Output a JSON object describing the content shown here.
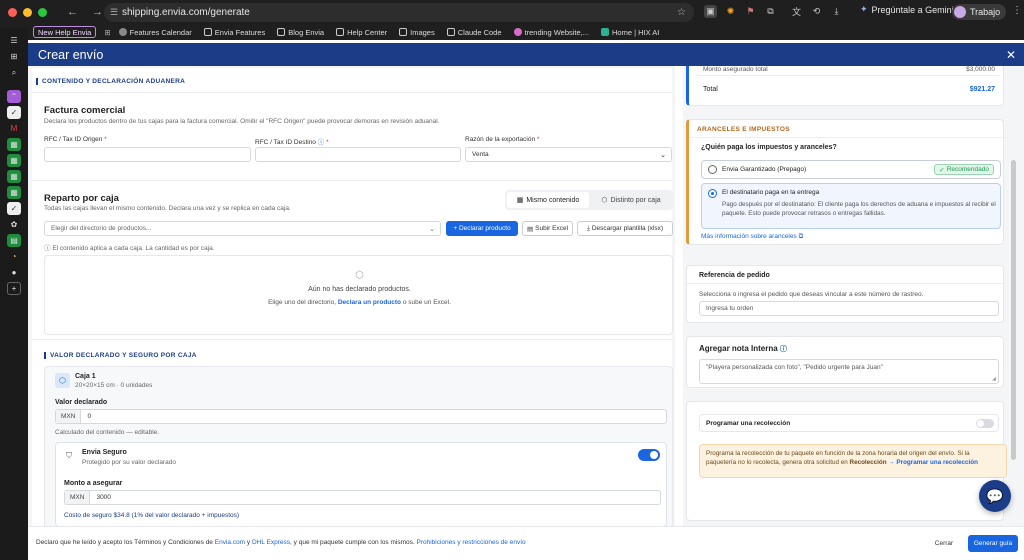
{
  "browser": {
    "url": "shipping.envia.com/generate",
    "gemini_label": "Pregúntale a Gemini",
    "profile_label": "Trabajo",
    "bookmarks": [
      {
        "label": "New Help Envia"
      },
      {
        "label": "Features Calendar"
      },
      {
        "label": "Envia Features"
      },
      {
        "label": "Blog Envia"
      },
      {
        "label": "Help Center"
      },
      {
        "label": "Images"
      },
      {
        "label": "Claude Code"
      },
      {
        "label": "trending Website,..."
      },
      {
        "label": "Home | HIX AI"
      }
    ]
  },
  "header": {
    "title": "Crear envío",
    "close": "✕"
  },
  "customs": {
    "section_title": "CONTENIDO Y DECLARACIÓN ADUANERA",
    "invoice_title": "Factura comercial",
    "invoice_desc": "Declara los productos dentro de tus cajas para la factura comercial. Omitir el \"RFC Origen\" puede provocar demoras en revisión aduanal.",
    "rfc_origin_label": "RFC / Tax ID Origen",
    "rfc_dest_label": "RFC / Tax ID Destino",
    "reason_label": "Razón de la exportación",
    "required_mark": "*",
    "reason_value": "Venta"
  },
  "boxes": {
    "title": "Reparto por caja",
    "desc": "Todas las cajas llevan el mismo contenido. Declara una vez y se replica en cada caja.",
    "tab_same": "Mismo contenido",
    "tab_diff": "Distinto por caja",
    "select_placeholder": "Elegir del directorio de productos...",
    "declare_btn": "+ Declarar producto",
    "upload_btn": "Subir Excel",
    "download_btn": "Descargar plantilla (xlsx)",
    "info": "El contenido aplica a cada caja. La cantidad es por caja.",
    "empty_title": "Aún no has declarado productos.",
    "empty_prefix": "Elige uno del directorio,",
    "empty_link": "Declara un producto",
    "empty_suffix": "o sube un Excel."
  },
  "value": {
    "section_title": "VALOR DECLARADO Y SEGURO POR CAJA",
    "box_name": "Caja 1",
    "box_dims": "20×20×15 cm · 0 unidades",
    "declared_label": "Valor declarado",
    "currency": "MXN",
    "declared_value": "0",
    "calc_note": "Calculado del contenido — editable.",
    "insurance_title": "Envia Seguro",
    "insurance_sub": "Protegido por su valor declarado",
    "insurance_on": true,
    "insure_label": "Monto a asegurar",
    "insure_value": "3000",
    "insure_cost": "Costo de seguro $34.8 (1% del valor declarado + impuestos)"
  },
  "summary": {
    "insured_label": "Monto asegurado total",
    "insured_value": "$3,000.00",
    "total_label": "Total",
    "total_value": "$921.27"
  },
  "taxes": {
    "section_title": "ARANCELES E IMPUESTOS",
    "question": "¿Quién paga los impuestos y aranceles?",
    "opt1": "Envia Garantizado (Prepago)",
    "opt1_badge": "Recomendado",
    "opt2": "El destinatario paga en la entrega",
    "opt2_desc": "Pago después por el destinatario: El cliente paga los derechos de aduana e impuestos al recibir el paquete. Esto puede provocar retrasos o entregas fallidas.",
    "more_link": "Más información sobre aranceles"
  },
  "reference": {
    "title": "Referencia de pedido",
    "desc": "Selecciona o ingresa el pedido que deseas vincular a este número de rastreo.",
    "placeholder": "Ingresa tu orden"
  },
  "note": {
    "title": "Agregar nota Interna",
    "placeholder": "\"Playera personalizada con foto\", \"Pedido urgente para Juan\""
  },
  "pickup": {
    "title": "Programar una recolección",
    "enabled": false,
    "warning": "Programa la recolección de tu paquete en función de la zona horaria del origen del envío. Si la paquetería no lo recolecta, genera otra solicitud en",
    "warning_bold": "Recolección",
    "warning_link": "→ Programar una recolección"
  },
  "footer": {
    "terms_1": "Declaro que he leído y acepto los Términos y Condiciones de",
    "terms_link1": "Envia.com",
    "terms_2": "y",
    "terms_link2": "DHL Express",
    "terms_3": ", y que mi paquete cumple con los mismos.",
    "terms_link3": "Prohibiciones y restricciones de envío",
    "cancel": "Cerrar",
    "submit": "Generar guía"
  },
  "colors": {
    "primary": "#1b3c87",
    "accent": "#1a66e0",
    "success": "#1f9d55",
    "warning_bg": "#fdf1e0"
  }
}
